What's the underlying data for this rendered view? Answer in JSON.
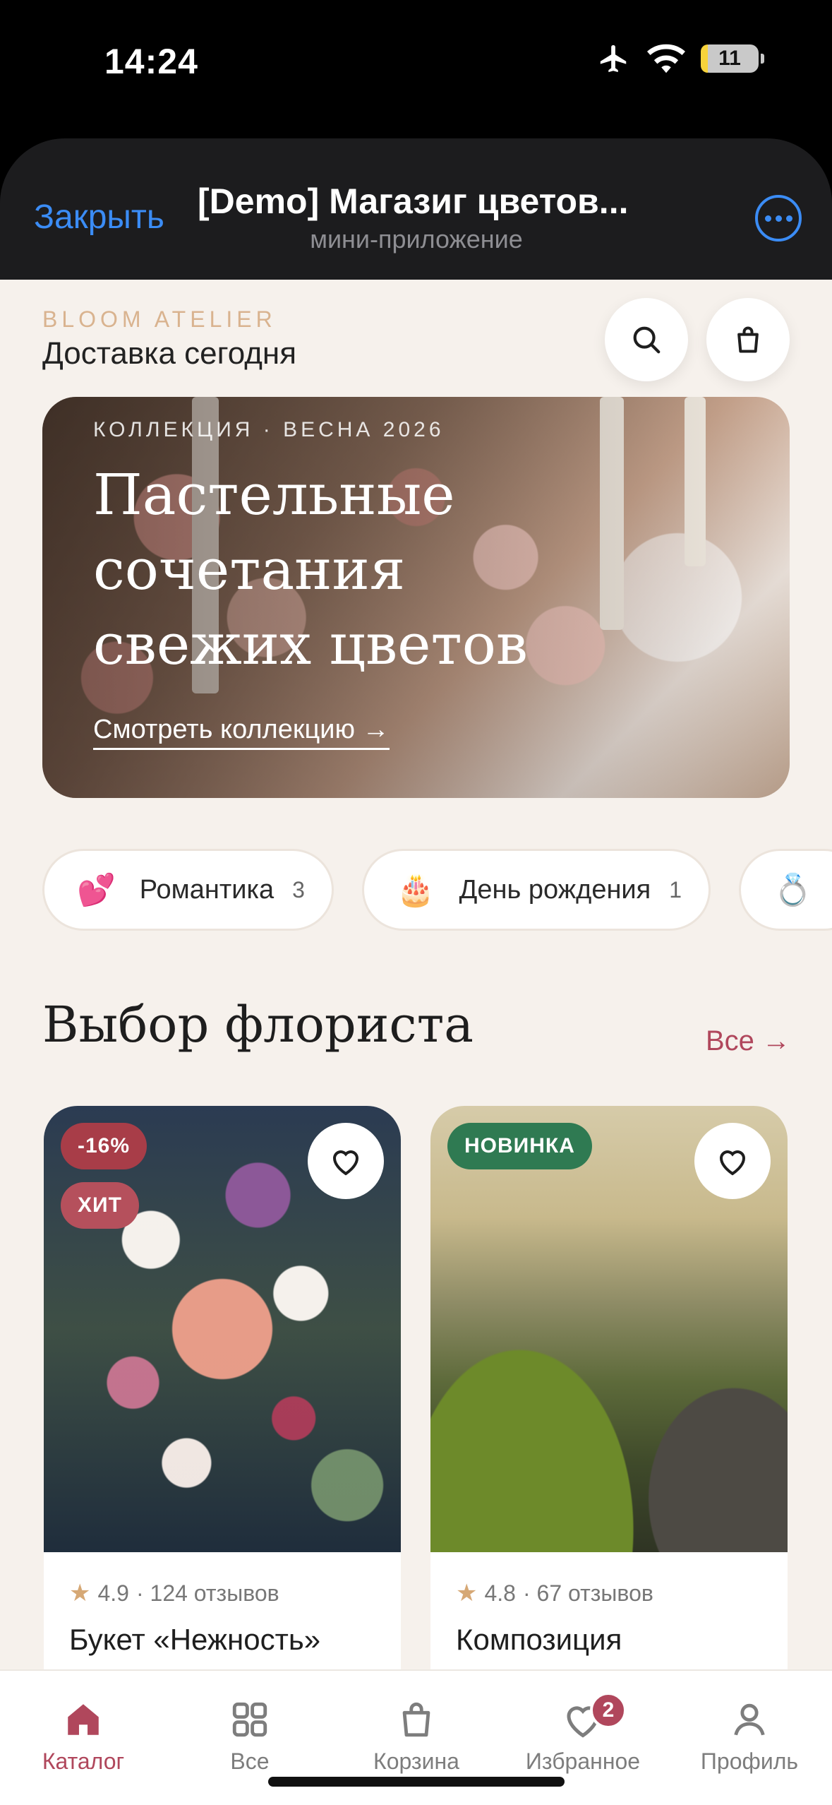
{
  "status_bar": {
    "time": "14:24",
    "battery": "11"
  },
  "sheet": {
    "close_label": "Закрыть",
    "title": "[Demo] Магазиг цветов...",
    "subtitle": "мини-приложение"
  },
  "header": {
    "brand": "BLOOM ATELIER",
    "delivery": "Доставка сегодня"
  },
  "hero": {
    "kicker": "КОЛЛЕКЦИЯ · ВЕСНА 2026",
    "title": "Пастельные сочетания свежих цветов",
    "link": "Смотреть коллекцию →"
  },
  "categories": [
    {
      "emoji": "💕",
      "label": "Романтика",
      "count": "3"
    },
    {
      "emoji": "🎂",
      "label": "День рождения",
      "count": "1"
    },
    {
      "emoji": "💍",
      "label": "",
      "count": ""
    }
  ],
  "section": {
    "title": "Выбор флориста",
    "all_label": "Все →"
  },
  "products": [
    {
      "badges": [
        "-16%",
        "ХИТ"
      ],
      "rating": "4.9",
      "reviews": "· 124 отзывов",
      "name": "Букет «Нежность»"
    },
    {
      "badges": [
        "НОВИНКА"
      ],
      "rating": "4.8",
      "reviews": "· 67 отзывов",
      "name": "Композиция"
    }
  ],
  "tabbar": [
    {
      "label": "Каталог",
      "icon": "home-icon",
      "active": true
    },
    {
      "label": "Все",
      "icon": "grid-icon"
    },
    {
      "label": "Корзина",
      "icon": "bag-icon"
    },
    {
      "label": "Избранное",
      "icon": "heart-icon",
      "badge": "2"
    },
    {
      "label": "Профиль",
      "icon": "user-icon"
    }
  ],
  "colors": {
    "accent": "#b0475c",
    "link_blue": "#3b8cf5",
    "background": "#f6f1ec",
    "badge_red": "#a83d48",
    "badge_green": "#2f7a52"
  }
}
